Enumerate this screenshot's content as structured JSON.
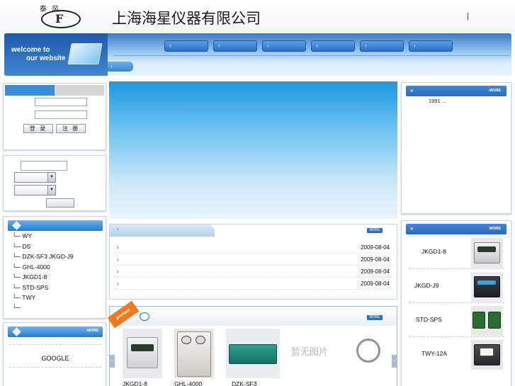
{
  "header": {
    "logo_text": "泰 风",
    "logo_emblem": "F",
    "company_name": "上海海星仪器有限公司",
    "divider": "|"
  },
  "nav": {
    "welcome_line1": "welcome to",
    "welcome_line2": "our website",
    "buttons": [
      "›",
      "›",
      "›",
      "›",
      "›",
      "›"
    ],
    "sub_button": "›"
  },
  "login": {
    "login_label": "登 录",
    "register_label": "注 册"
  },
  "categories": {
    "items": [
      "└─ WY",
      "└─ DS",
      "└─ DZK-SF3 JKGD-J9",
      "└─ GHL-4000",
      "└─ JKGD1-8",
      "└─ STD-SPS",
      "└─ TWY",
      "└─"
    ]
  },
  "links": {
    "more": "MORE",
    "google": "GOOGLE"
  },
  "news": {
    "tab_arrow": "›",
    "more": "MORE",
    "rows": [
      {
        "bullet": "›",
        "date": "2009-08-04"
      },
      {
        "bullet": "›",
        "date": "2009-08-04"
      },
      {
        "bullet": "›",
        "date": "2009-08-04"
      },
      {
        "bullet": "›",
        "date": "2009-08-04"
      }
    ]
  },
  "products": {
    "ribbon": "product",
    "more": "MORE",
    "prev": "‹",
    "next": "›",
    "items": [
      {
        "label": "JKGD1-8"
      },
      {
        "label": "GHL-4000"
      },
      {
        "label": "DZK-SF3"
      },
      {
        "label": "暂无图片"
      }
    ]
  },
  "about": {
    "chev": "»",
    "more": "MORE",
    "text": "1991    ..."
  },
  "right_products": {
    "chev": "»",
    "more": "MORE",
    "items": [
      {
        "label": "JKGD1-8"
      },
      {
        "label": "JKGD-J9"
      },
      {
        "label": "STD-SPS"
      },
      {
        "label": "TWY-12A"
      }
    ]
  },
  "colors": {
    "nav_blue": "#2a6fc4",
    "banner_top": "#1d97e0",
    "ribbon_orange": "#f07a1f"
  }
}
